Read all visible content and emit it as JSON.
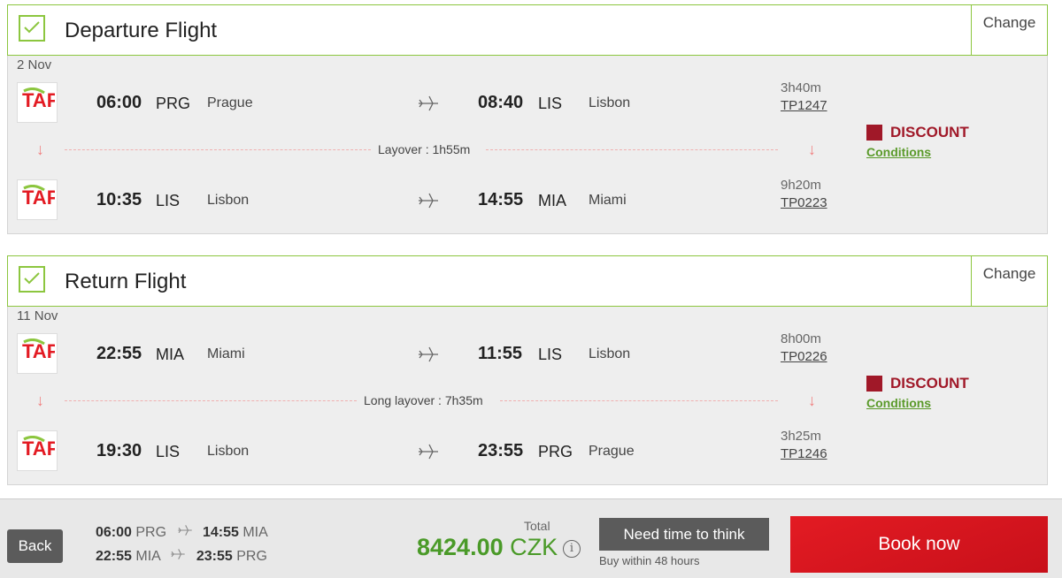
{
  "departure": {
    "title": "Departure Flight",
    "change_label": "Change",
    "date": "2 Nov",
    "segments": [
      {
        "dep_time": "06:00",
        "dep_code": "PRG",
        "dep_city": "Prague",
        "arr_time": "08:40",
        "arr_code": "LIS",
        "arr_city": "Lisbon",
        "duration": "3h40m",
        "flight_no": "TP1247"
      },
      {
        "dep_time": "10:35",
        "dep_code": "LIS",
        "dep_city": "Lisbon",
        "arr_time": "14:55",
        "arr_code": "MIA",
        "arr_city": "Miami",
        "duration": "9h20m",
        "flight_no": "TP0223"
      }
    ],
    "layover": "Layover : 1h55m",
    "discount_label": "DISCOUNT",
    "conditions_label": "Conditions"
  },
  "return": {
    "title": "Return Flight",
    "change_label": "Change",
    "date": "11 Nov",
    "segments": [
      {
        "dep_time": "22:55",
        "dep_code": "MIA",
        "dep_city": "Miami",
        "arr_time": "11:55",
        "arr_code": "LIS",
        "arr_city": "Lisbon",
        "duration": "8h00m",
        "flight_no": "TP0226"
      },
      {
        "dep_time": "19:30",
        "dep_code": "LIS",
        "dep_city": "Lisbon",
        "arr_time": "23:55",
        "arr_code": "PRG",
        "arr_city": "Prague",
        "duration": "3h25m",
        "flight_no": "TP1246"
      }
    ],
    "layover": "Long layover : 7h35m",
    "discount_label": "DISCOUNT",
    "conditions_label": "Conditions"
  },
  "airline_logo_text": "TAP",
  "footer": {
    "back_label": "Back",
    "summary": [
      {
        "dep_time": "06:00",
        "dep_code": "PRG",
        "arr_time": "14:55",
        "arr_code": "MIA"
      },
      {
        "dep_time": "22:55",
        "dep_code": "MIA",
        "arr_time": "23:55",
        "arr_code": "PRG"
      }
    ],
    "total_label": "Total",
    "total_amount": "8424.00",
    "currency": "CZK",
    "info_glyph": "i",
    "think_label": "Need time to think",
    "think_sub": "Buy within 48 hours",
    "book_label": "Book now"
  },
  "colors": {
    "accent_green": "#8cc63f",
    "price_green": "#4a9a28",
    "discount_red": "#a01828",
    "book_red": "#e31b23",
    "layover_arrow": "#f08080"
  },
  "icons": [
    "check-icon",
    "tap-logo",
    "plane-icon",
    "arrow-down-icon",
    "discount-badge-icon",
    "info-icon"
  ]
}
